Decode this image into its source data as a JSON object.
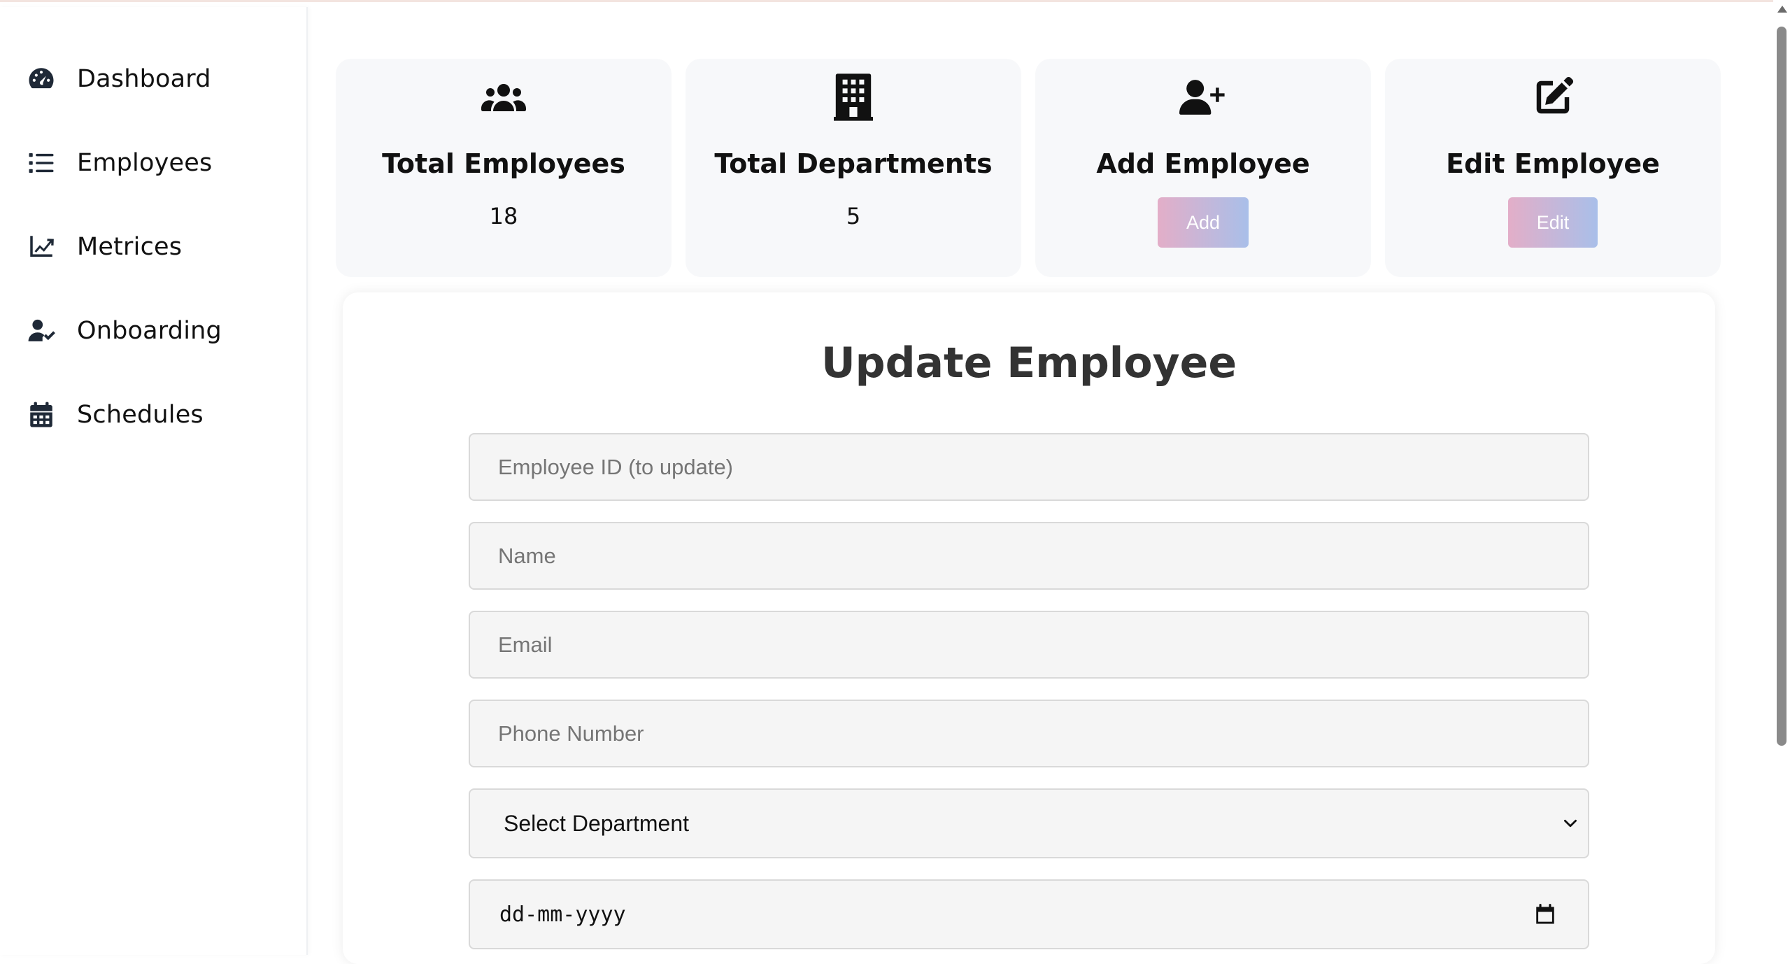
{
  "sidebar": {
    "items": [
      {
        "label": "Dashboard",
        "icon": "gauge-icon"
      },
      {
        "label": "Employees",
        "icon": "list-icon"
      },
      {
        "label": "Metrices",
        "icon": "line-chart-icon"
      },
      {
        "label": "Onboarding",
        "icon": "user-check-icon"
      },
      {
        "label": "Schedules",
        "icon": "calendar-icon"
      }
    ]
  },
  "cards": {
    "total_employees": {
      "title": "Total Employees",
      "value": "18",
      "icon": "users-icon"
    },
    "total_departments": {
      "title": "Total Departments",
      "value": "5",
      "icon": "building-icon"
    },
    "add_employee": {
      "title": "Add Employee",
      "button": "Add",
      "icon": "user-plus-icon"
    },
    "edit_employee": {
      "title": "Edit Employee",
      "button": "Edit",
      "icon": "edit-icon"
    }
  },
  "form": {
    "title": "Update Employee",
    "employee_id_placeholder": "Employee ID (to update)",
    "name_placeholder": "Name",
    "email_placeholder": "Email",
    "phone_placeholder": "Phone Number",
    "department_selected": "Select Department",
    "date_placeholder": "dd-mm-yyyy"
  },
  "colors": {
    "button_gradient_start": "#e3aec8",
    "button_gradient_end": "#a9bfe9",
    "card_background": "#f7f8fa",
    "input_background": "#f5f5f5"
  }
}
